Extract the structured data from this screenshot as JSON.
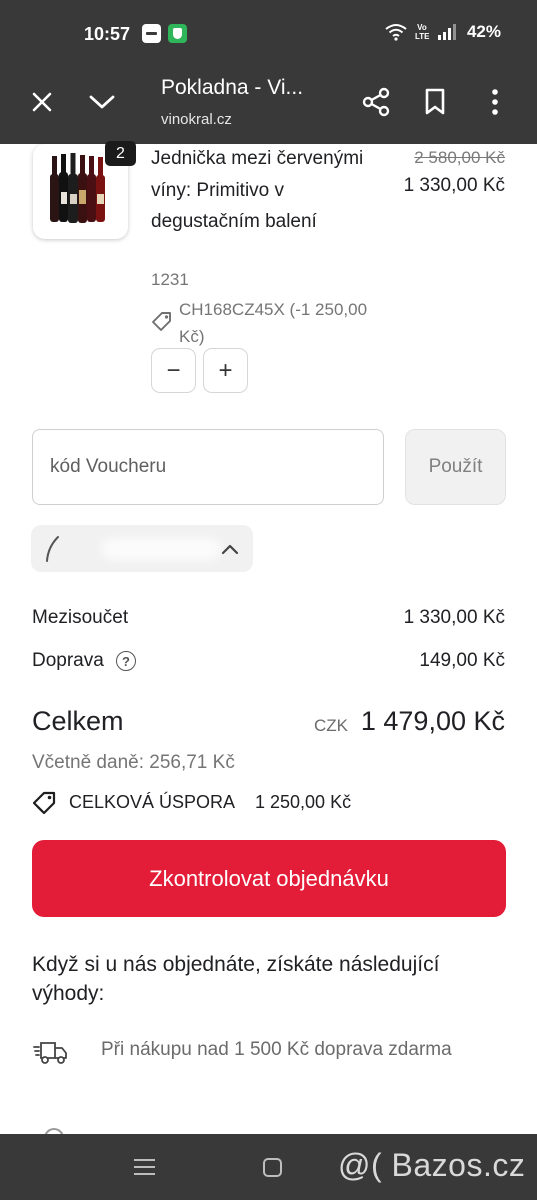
{
  "status_bar": {
    "time": "10:57",
    "volte": "Vo LTE",
    "battery": "42%"
  },
  "browser": {
    "title": "Pokladna - Vi...",
    "url": "vinokral.cz",
    "icons": [
      "close-icon",
      "chevron-down-icon",
      "share-icon",
      "bookmark-icon",
      "more-vert-icon"
    ]
  },
  "product": {
    "quantity_badge": "2",
    "name": "Jednička mezi červenými víny: Primitivo v degustačním balení",
    "price_original": "2 580,00 Kč",
    "price_current": "1 330,00 Kč",
    "sku": "1231",
    "discount_code": "CH168CZ45X (-1 250,00 Kč)",
    "decrease_label": "−",
    "increase_label": "+"
  },
  "voucher": {
    "placeholder": "kód Voucheru",
    "apply_label": "Použít"
  },
  "summary": {
    "subtotal_label": "Mezisoučet",
    "subtotal_value": "1 330,00 Kč",
    "shipping_label": "Doprava",
    "shipping_help": "?",
    "shipping_value": "149,00 Kč",
    "total_label": "Celkem",
    "currency": "CZK",
    "total_value": "1 479,00 Kč",
    "tax_text": "Včetně daně: 256,71 Kč",
    "savings_label": "CELKOVÁ ÚSPORA",
    "savings_value": "1 250,00 Kč"
  },
  "checkout": {
    "button_label": "Zkontrolovat objednávku",
    "accent_color": "#e31c37"
  },
  "benefits": {
    "title": "Když si u nás objednáte, získáte následující výhody:",
    "items": [
      {
        "icon": "delivery-truck-icon",
        "text": "Při nákupu nad 1 500 Kč doprava zdarma"
      }
    ]
  },
  "watermark": "@( Bazos.cz"
}
